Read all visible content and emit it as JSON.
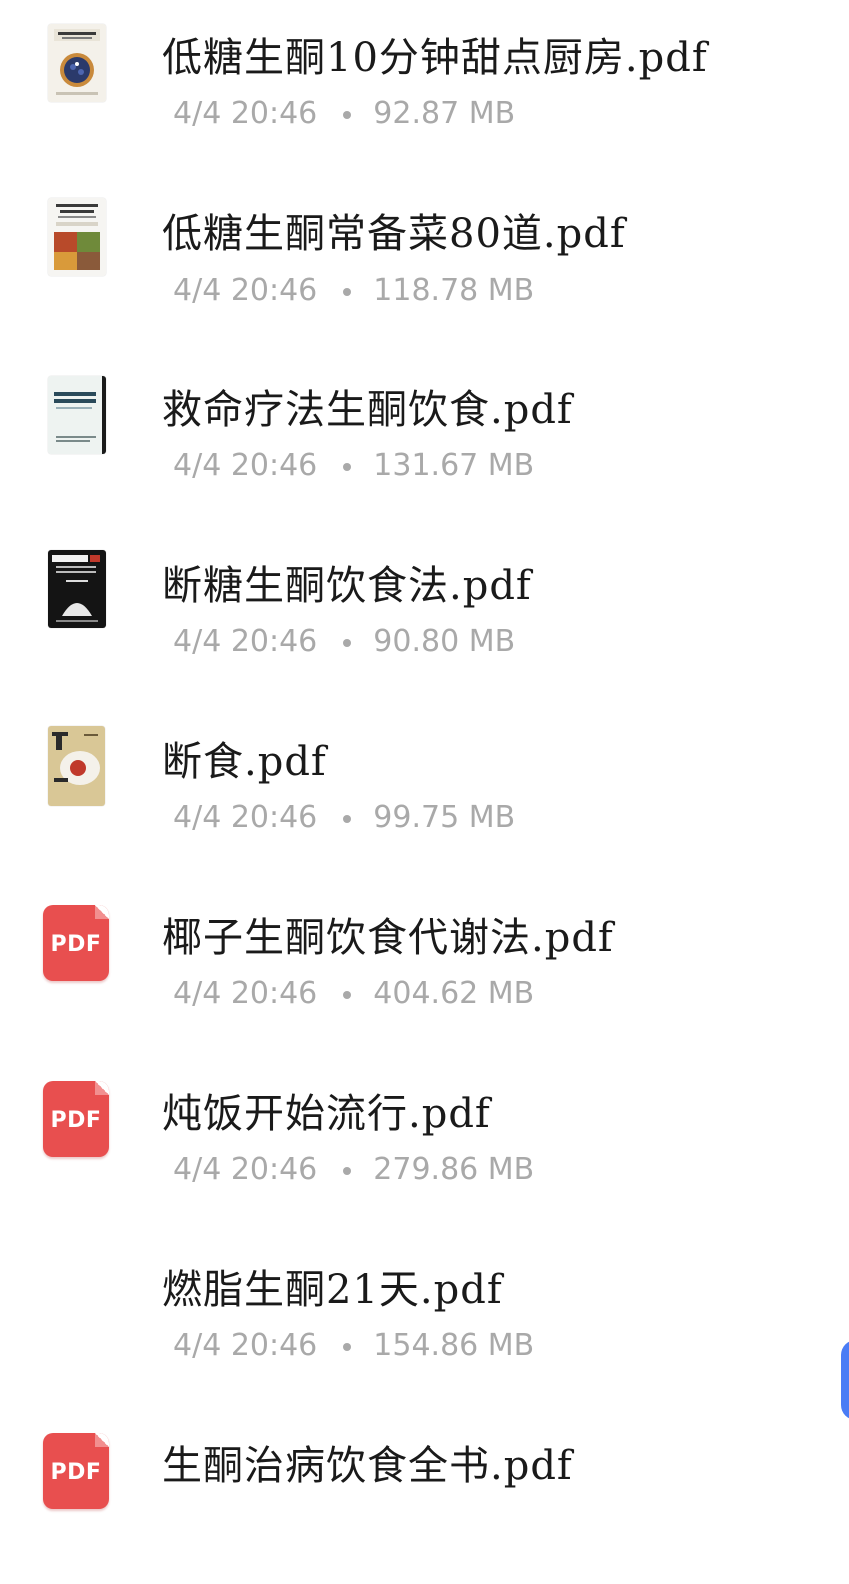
{
  "files": [
    {
      "name": "低糖生酮10分钟甜点厨房.pdf",
      "date": "4/4 20:46",
      "size": "92.87 MB",
      "thumb": "cover-dessert-book"
    },
    {
      "name": "低糖生酮常备菜80道.pdf",
      "date": "4/4 20:46",
      "size": "118.78 MB",
      "thumb": "cover-dishes-book"
    },
    {
      "name": "救命疗法生酮饮食.pdf",
      "date": "4/4 20:46",
      "size": "131.67 MB",
      "thumb": "cover-therapy-book"
    },
    {
      "name": "断糖生酮饮食法.pdf",
      "date": "4/4 20:46",
      "size": "90.80 MB",
      "thumb": "cover-sugar-book"
    },
    {
      "name": "断食.pdf",
      "date": "4/4 20:46",
      "size": "99.75 MB",
      "thumb": "cover-fasting-book"
    },
    {
      "name": "椰子生酮饮食代谢法.pdf",
      "date": "4/4 20:46",
      "size": "404.62 MB",
      "thumb": "pdf-icon"
    },
    {
      "name": "炖饭开始流行.pdf",
      "date": "4/4 20:46",
      "size": "279.86 MB",
      "thumb": "pdf-icon"
    },
    {
      "name": "燃脂生酮21天.pdf",
      "date": "4/4 20:46",
      "size": "154.86 MB",
      "thumb": "none"
    },
    {
      "name": "生酮治病饮食全书.pdf",
      "date": "",
      "size": "",
      "thumb": "pdf-icon"
    }
  ],
  "pdf_icon_label": "PDF",
  "colors": {
    "pdf_red": "#e84f4f",
    "meta_gray": "#a9a9a9",
    "scroll_accent": "#4a7cf5"
  }
}
